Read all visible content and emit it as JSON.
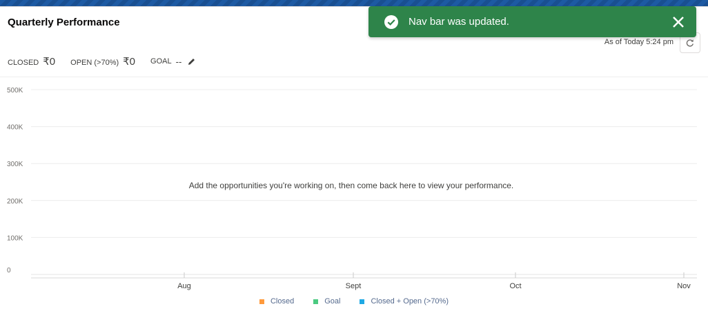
{
  "card": {
    "title": "Quarterly Performance",
    "as_of": "As of Today 5:24 pm",
    "refresh_icon": "refresh-icon"
  },
  "metrics": {
    "closed_label": "CLOSED",
    "closed_value": "₹0",
    "open_label": "OPEN (>70%)",
    "open_value": "₹0",
    "goal_label": "GOAL",
    "goal_value": "--",
    "goal_edit_icon": "pencil-icon"
  },
  "empty_message": "Add the opportunities you're working on, then come back here to view your performance.",
  "toast": {
    "message": "Nav bar was updated.",
    "icon": "success-check-icon",
    "close_icon": "close-icon",
    "color": "#2e844a"
  },
  "chart_data": {
    "type": "line",
    "categories": [
      "Aug",
      "Sept",
      "Oct",
      "Nov"
    ],
    "y_ticks": [
      "0",
      "100K",
      "200K",
      "300K",
      "400K",
      "500K"
    ],
    "ylim": [
      0,
      500000
    ],
    "grid": true,
    "legend_position": "bottom",
    "series": [
      {
        "name": "Closed",
        "color": "#ff9a3c",
        "values": []
      },
      {
        "name": "Goal",
        "color": "#4bca81",
        "values": []
      },
      {
        "name": "Closed + Open (>70%)",
        "color": "#1fa9e4",
        "values": []
      }
    ]
  }
}
